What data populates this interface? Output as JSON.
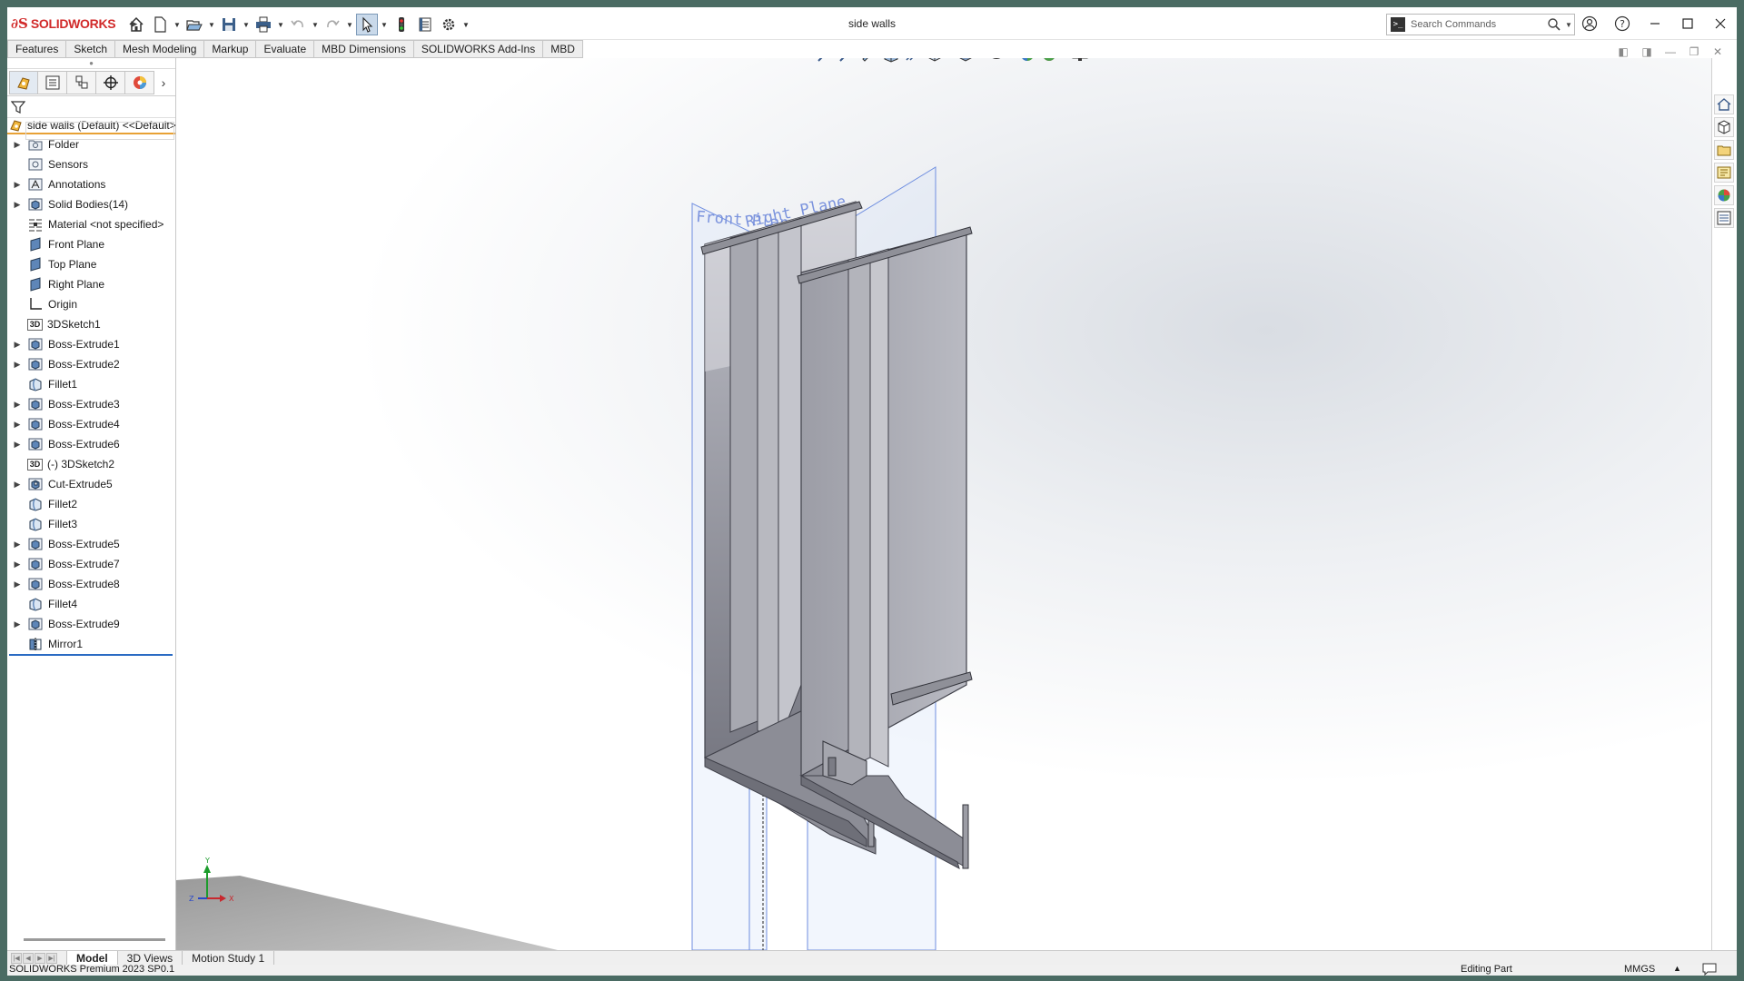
{
  "app": {
    "brand": "SOLIDWORKS",
    "document_title": "side walls",
    "search_placeholder": "Search Commands"
  },
  "command_tabs": [
    "Features",
    "Sketch",
    "Mesh Modeling",
    "Markup",
    "Evaluate",
    "MBD Dimensions",
    "SOLIDWORKS Add-Ins",
    "MBD"
  ],
  "feature_manager": {
    "root": "side walls (Default) <<Default>_Displa",
    "items": [
      {
        "label": "Folder",
        "icon": "folder-icon",
        "expandable": true
      },
      {
        "label": "Sensors",
        "icon": "sensors-icon",
        "expandable": false
      },
      {
        "label": "Annotations",
        "icon": "annotations-icon",
        "expandable": true
      },
      {
        "label": "Solid Bodies(14)",
        "icon": "solid-bodies-icon",
        "expandable": true
      },
      {
        "label": "Material <not specified>",
        "icon": "material-icon",
        "expandable": false
      },
      {
        "label": "Front Plane",
        "icon": "plane-icon",
        "expandable": false
      },
      {
        "label": "Top Plane",
        "icon": "plane-icon",
        "expandable": false
      },
      {
        "label": "Right Plane",
        "icon": "plane-icon",
        "expandable": false
      },
      {
        "label": "Origin",
        "icon": "origin-icon",
        "expandable": false
      },
      {
        "label": "3DSketch1",
        "icon": "3d-sketch-icon",
        "expandable": false
      },
      {
        "label": "Boss-Extrude1",
        "icon": "extrude-icon",
        "expandable": true
      },
      {
        "label": "Boss-Extrude2",
        "icon": "extrude-icon",
        "expandable": true
      },
      {
        "label": "Fillet1",
        "icon": "fillet-icon",
        "expandable": false
      },
      {
        "label": "Boss-Extrude3",
        "icon": "extrude-icon",
        "expandable": true
      },
      {
        "label": "Boss-Extrude4",
        "icon": "extrude-icon",
        "expandable": true
      },
      {
        "label": "Boss-Extrude6",
        "icon": "extrude-icon",
        "expandable": true
      },
      {
        "label": "(-) 3DSketch2",
        "icon": "3d-sketch-icon",
        "expandable": false
      },
      {
        "label": "Cut-Extrude5",
        "icon": "cut-extrude-icon",
        "expandable": true
      },
      {
        "label": "Fillet2",
        "icon": "fillet-icon",
        "expandable": false
      },
      {
        "label": "Fillet3",
        "icon": "fillet-icon",
        "expandable": false
      },
      {
        "label": "Boss-Extrude5",
        "icon": "extrude-icon",
        "expandable": true
      },
      {
        "label": "Boss-Extrude7",
        "icon": "extrude-icon",
        "expandable": true
      },
      {
        "label": "Boss-Extrude8",
        "icon": "extrude-icon",
        "expandable": true
      },
      {
        "label": "Fillet4",
        "icon": "fillet-icon",
        "expandable": false
      },
      {
        "label": "Boss-Extrude9",
        "icon": "extrude-icon",
        "expandable": true
      },
      {
        "label": "Mirror1",
        "icon": "mirror-icon",
        "expandable": false
      }
    ]
  },
  "viewport": {
    "plane_labels": [
      "Front Plane",
      "Right Plane"
    ],
    "triad_labels": {
      "x": "X",
      "y": "Y",
      "z": "Z"
    }
  },
  "sheet_tabs": [
    "Model",
    "3D Views",
    "Motion Study 1"
  ],
  "status": {
    "product": "SOLIDWORKS Premium 2023 SP0.1",
    "mode": "Editing Part",
    "units": "MMGS"
  },
  "colors": {
    "brand_red": "#d12a2a",
    "rollback_blue": "#2a6bc3",
    "root_underline": "#e8a135",
    "plane_blue": "#6f8ee0"
  }
}
